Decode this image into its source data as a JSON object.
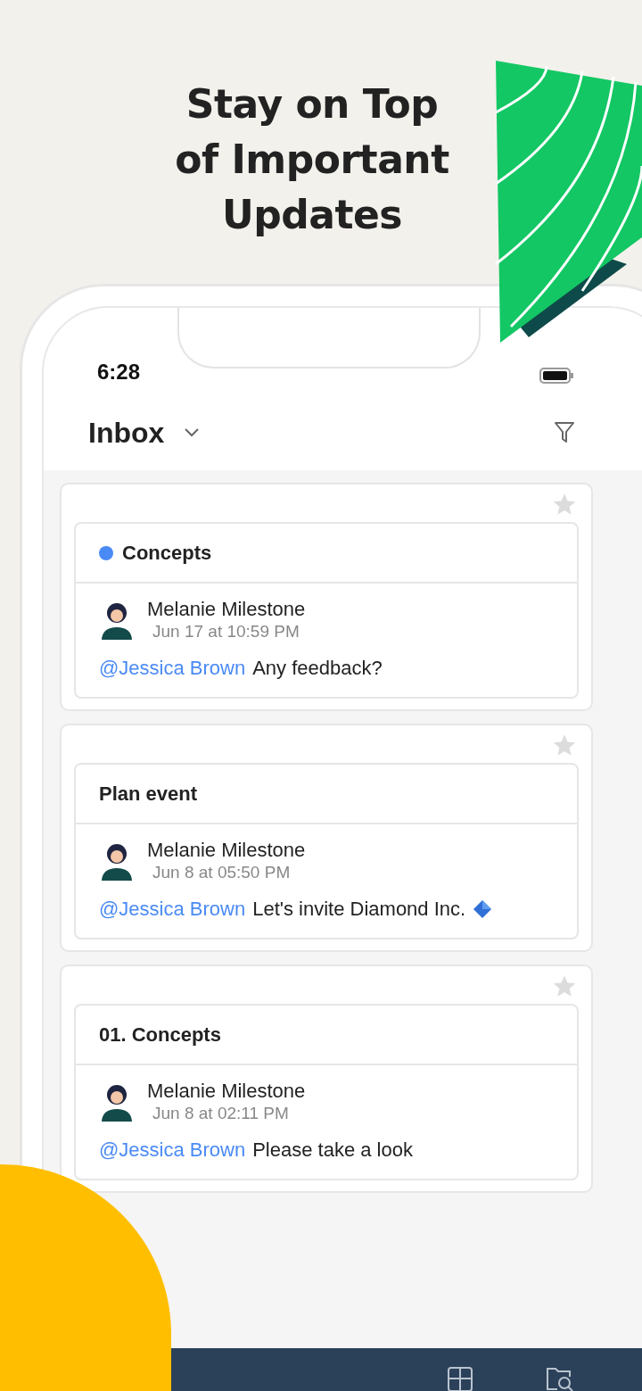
{
  "headline": {
    "lines": [
      "Stay on Top",
      "of Important",
      "Updates"
    ]
  },
  "status_bar": {
    "time": "6:28"
  },
  "header": {
    "title": "Inbox"
  },
  "threads": [
    {
      "title": "Concepts",
      "color": "#4a8af4",
      "starred": false,
      "author": "Melanie Milestone",
      "date": "Jun 17 at 10:59 PM",
      "mention": "@Jessica Brown",
      "message": "Any feedback?"
    },
    {
      "title": "Plan event",
      "starred": false,
      "author": "Melanie Milestone",
      "date": "Jun 8 at 05:50 PM",
      "mention": "@Jessica Brown",
      "message": "Let's invite Diamond Inc.",
      "diamond_icon": true
    },
    {
      "title": "01. Concepts",
      "starred": false,
      "author": "Melanie Milestone",
      "date": "Jun 8 at 02:11 PM",
      "mention": "@Jessica Brown",
      "message": "Please take a look"
    }
  ]
}
